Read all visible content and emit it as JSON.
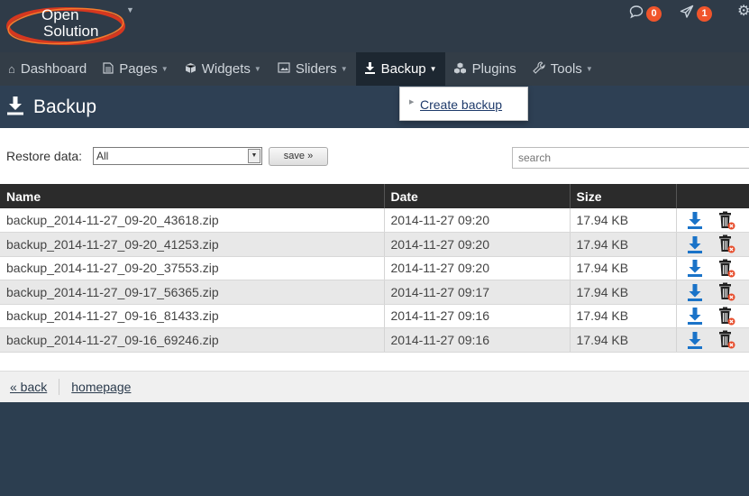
{
  "logo": {
    "line1": "Open",
    "line2": "Solution"
  },
  "topbar": {
    "comments_count": "0",
    "notifications_count": "1",
    "comment_icon": "comment-icon",
    "notification_icon": "paper-plane-icon",
    "settings_icon": "gear-icon"
  },
  "nav": {
    "items": [
      {
        "label": "Dashboard",
        "icon": "home-icon",
        "has_caret": false
      },
      {
        "label": "Pages",
        "icon": "file-icon",
        "has_caret": true
      },
      {
        "label": "Widgets",
        "icon": "cube-icon",
        "has_caret": true
      },
      {
        "label": "Sliders",
        "icon": "image-icon",
        "has_caret": true
      },
      {
        "label": "Backup",
        "icon": "download-icon",
        "has_caret": true,
        "active": true
      },
      {
        "label": "Plugins",
        "icon": "cubes-icon",
        "has_caret": false
      },
      {
        "label": "Tools",
        "icon": "wrench-icon",
        "has_caret": true
      }
    ],
    "dropdown": {
      "item": "Create backup"
    }
  },
  "page": {
    "title": "Backup"
  },
  "filters": {
    "restore_label": "Restore data:",
    "restore_value": "All",
    "save_label": "save »",
    "search_placeholder": "search"
  },
  "table": {
    "headers": {
      "name": "Name",
      "date": "Date",
      "size": "Size"
    },
    "rows": [
      {
        "name": "backup_2014-11-27_09-20_43618.zip",
        "date": "2014-11-27 09:20",
        "size": "17.94 KB"
      },
      {
        "name": "backup_2014-11-27_09-20_41253.zip",
        "date": "2014-11-27 09:20",
        "size": "17.94 KB"
      },
      {
        "name": "backup_2014-11-27_09-20_37553.zip",
        "date": "2014-11-27 09:20",
        "size": "17.94 KB"
      },
      {
        "name": "backup_2014-11-27_09-17_56365.zip",
        "date": "2014-11-27 09:17",
        "size": "17.94 KB"
      },
      {
        "name": "backup_2014-11-27_09-16_81433.zip",
        "date": "2014-11-27 09:16",
        "size": "17.94 KB"
      },
      {
        "name": "backup_2014-11-27_09-16_69246.zip",
        "date": "2014-11-27 09:16",
        "size": "17.94 KB"
      }
    ]
  },
  "footer": {
    "back": "« back",
    "homepage": "homepage"
  },
  "colors": {
    "accent_orange": "#f0552b",
    "download_blue": "#1a73c8",
    "nav_bg": "#333d47",
    "header_bg": "#2e4054"
  }
}
